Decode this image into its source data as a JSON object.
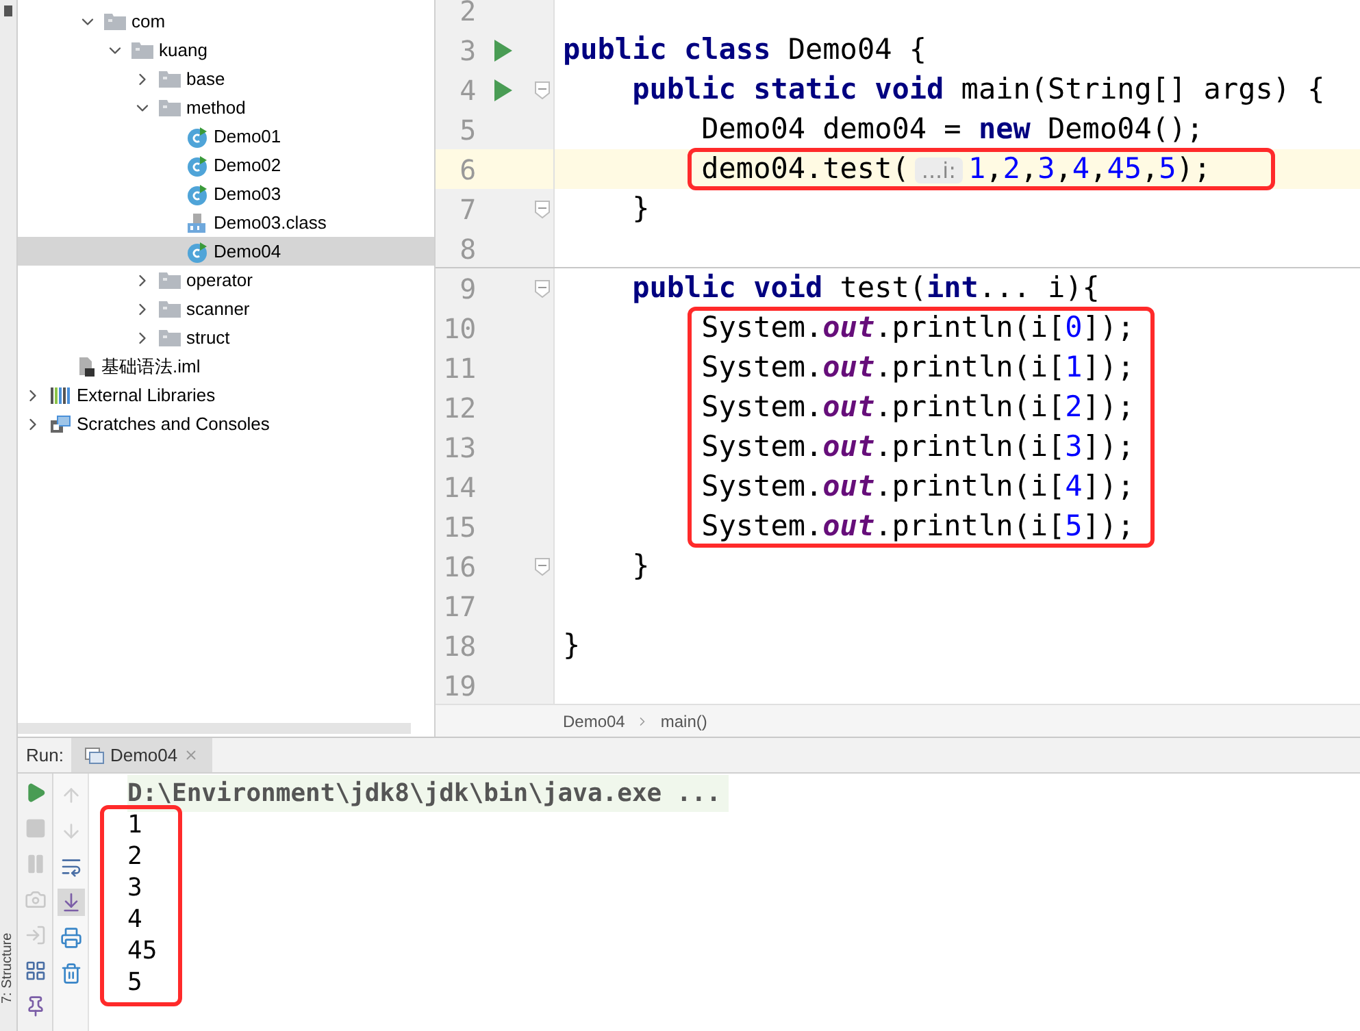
{
  "tool_stripe": {
    "structure_tab": "7: Structure"
  },
  "project_tree": [
    {
      "children": [
        {
          "children": [
            {
              "label": "com",
              "kind": "folder",
              "expanded": true,
              "selected": false,
              "children": [
                {
                  "label": "kuang",
                  "kind": "folder",
                  "expanded": true,
                  "selected": false,
                  "children": [
                    {
                      "label": "base",
                      "kind": "folder",
                      "expanded": false,
                      "selected": false
                    },
                    {
                      "label": "method",
                      "kind": "folder",
                      "expanded": true,
                      "selected": false,
                      "children": [
                        {
                          "label": "Demo01",
                          "kind": "class",
                          "selected": false
                        },
                        {
                          "label": "Demo02",
                          "kind": "class",
                          "selected": false
                        },
                        {
                          "label": "Demo03",
                          "kind": "class",
                          "selected": false
                        },
                        {
                          "label": "Demo03.class",
                          "kind": "classfile",
                          "selected": false
                        },
                        {
                          "label": "Demo04",
                          "kind": "class",
                          "selected": true
                        }
                      ]
                    },
                    {
                      "label": "operator",
                      "kind": "folder",
                      "expanded": false,
                      "selected": false
                    },
                    {
                      "label": "scanner",
                      "kind": "folder",
                      "expanded": false,
                      "selected": false
                    },
                    {
                      "label": "struct",
                      "kind": "folder",
                      "expanded": false,
                      "selected": false
                    }
                  ]
                }
              ]
            }
          ]
        },
        {
          "label": "基础语法.iml",
          "kind": "iml",
          "selected": false
        }
      ]
    },
    {
      "label": "External Libraries",
      "kind": "library",
      "expanded": false,
      "selected": false
    },
    {
      "label": "Scratches and Consoles",
      "kind": "scratches",
      "expanded": false,
      "selected": false
    }
  ],
  "editor": {
    "lines": [
      {
        "number": "2"
      },
      {
        "number": "3",
        "run": true,
        "tokens": [
          {
            "text": "public class ",
            "kind": "kw"
          },
          {
            "text": "Demo04 {",
            "kind": "plain"
          }
        ]
      },
      {
        "number": "4",
        "run": true,
        "fold": true,
        "tokens": [
          {
            "text": "    public static void ",
            "kind": "kw"
          },
          {
            "text": "main(String[] args) {",
            "kind": "plain"
          }
        ]
      },
      {
        "number": "5",
        "tokens": [
          {
            "text": "        Demo04 demo04 = ",
            "kind": "plain"
          },
          {
            "text": "new ",
            "kind": "kw"
          },
          {
            "text": "Demo04();",
            "kind": "plain"
          }
        ]
      },
      {
        "number": "6",
        "tokens": [
          {
            "text": "        demo04.test(",
            "kind": "plain"
          },
          {
            "text": "...i:",
            "kind": "hint"
          },
          {
            "text": "1",
            "kind": "num"
          },
          {
            "text": ",",
            "kind": "plain"
          },
          {
            "text": "2",
            "kind": "num"
          },
          {
            "text": ",",
            "kind": "plain"
          },
          {
            "text": "3",
            "kind": "num"
          },
          {
            "text": ",",
            "kind": "plain"
          },
          {
            "text": "4",
            "kind": "num"
          },
          {
            "text": ",",
            "kind": "plain"
          },
          {
            "text": "45",
            "kind": "num"
          },
          {
            "text": ",",
            "kind": "plain"
          },
          {
            "text": "5",
            "kind": "num"
          },
          {
            "text": ");",
            "kind": "plain"
          }
        ],
        "boxed": true,
        "current": true
      },
      {
        "number": "7",
        "fold": true,
        "tokens": [
          {
            "text": "    }",
            "kind": "plain"
          }
        ]
      },
      {
        "number": "8",
        "separator_after": true
      },
      {
        "number": "9",
        "fold": true,
        "tokens": [
          {
            "text": "    public void ",
            "kind": "kw"
          },
          {
            "text": "test(",
            "kind": "plain"
          },
          {
            "text": "int",
            "kind": "kw"
          },
          {
            "text": "... i){",
            "kind": "plain"
          }
        ]
      },
      {
        "number": "10",
        "tokens": [
          {
            "text": "        System.",
            "kind": "plain"
          },
          {
            "text": "out",
            "kind": "field"
          },
          {
            "text": ".println(i[",
            "kind": "plain"
          },
          {
            "text": "0",
            "kind": "num"
          },
          {
            "text": "]);",
            "kind": "plain"
          }
        ],
        "boxed": true
      },
      {
        "number": "11",
        "tokens": [
          {
            "text": "        System.",
            "kind": "plain"
          },
          {
            "text": "out",
            "kind": "field"
          },
          {
            "text": ".println(i[",
            "kind": "plain"
          },
          {
            "text": "1",
            "kind": "num"
          },
          {
            "text": "]);",
            "kind": "plain"
          }
        ],
        "boxed": true
      },
      {
        "number": "12",
        "tokens": [
          {
            "text": "        System.",
            "kind": "plain"
          },
          {
            "text": "out",
            "kind": "field"
          },
          {
            "text": ".println(i[",
            "kind": "plain"
          },
          {
            "text": "2",
            "kind": "num"
          },
          {
            "text": "]);",
            "kind": "plain"
          }
        ],
        "boxed": true
      },
      {
        "number": "13",
        "tokens": [
          {
            "text": "        System.",
            "kind": "plain"
          },
          {
            "text": "out",
            "kind": "field"
          },
          {
            "text": ".println(i[",
            "kind": "plain"
          },
          {
            "text": "3",
            "kind": "num"
          },
          {
            "text": "]);",
            "kind": "plain"
          }
        ],
        "boxed": true
      },
      {
        "number": "14",
        "tokens": [
          {
            "text": "        System.",
            "kind": "plain"
          },
          {
            "text": "out",
            "kind": "field"
          },
          {
            "text": ".println(i[",
            "kind": "plain"
          },
          {
            "text": "4",
            "kind": "num"
          },
          {
            "text": "]);",
            "kind": "plain"
          }
        ],
        "boxed": true
      },
      {
        "number": "15",
        "tokens": [
          {
            "text": "        System.",
            "kind": "plain"
          },
          {
            "text": "out",
            "kind": "field"
          },
          {
            "text": ".println(i[",
            "kind": "plain"
          },
          {
            "text": "5",
            "kind": "num"
          },
          {
            "text": "]);",
            "kind": "plain"
          }
        ],
        "boxed": true
      },
      {
        "number": "16",
        "fold": true,
        "tokens": [
          {
            "text": "    }",
            "kind": "plain"
          }
        ]
      },
      {
        "number": "17"
      },
      {
        "number": "18",
        "tokens": [
          {
            "text": "}",
            "kind": "plain"
          }
        ]
      },
      {
        "number": "19"
      }
    ],
    "breadcrumbs": [
      "Demo04",
      "main()"
    ]
  },
  "run_panel": {
    "label": "Run:",
    "tab": {
      "title": "Demo04",
      "selected": true
    },
    "left_toolbar": [
      {
        "kind": "run",
        "disabled": false
      },
      {
        "kind": "stop",
        "disabled": true
      },
      {
        "kind": "pause",
        "disabled": true
      },
      {
        "kind": "camera",
        "disabled": true
      },
      {
        "kind": "exit",
        "disabled": true
      },
      {
        "kind": "layout",
        "disabled": false
      },
      {
        "kind": "pin",
        "disabled": false
      }
    ],
    "right_toolbar": [
      {
        "kind": "up",
        "disabled": true,
        "selected": false
      },
      {
        "kind": "down",
        "disabled": true,
        "selected": false
      },
      {
        "kind": "wrap",
        "disabled": false,
        "selected": false
      },
      {
        "kind": "scroll-end",
        "disabled": false,
        "selected": true
      },
      {
        "kind": "print",
        "disabled": false,
        "selected": false
      },
      {
        "kind": "trash",
        "disabled": false,
        "selected": false
      }
    ],
    "console": [
      {
        "text": "D:\\Environment\\jdk8\\jdk\\bin\\java.exe ...",
        "kind": "command"
      },
      {
        "text": "1",
        "kind": "output",
        "boxed": true
      },
      {
        "text": "2",
        "kind": "output",
        "boxed": true
      },
      {
        "text": "3",
        "kind": "output",
        "boxed": true
      },
      {
        "text": "4",
        "kind": "output",
        "boxed": true
      },
      {
        "text": "45",
        "kind": "output",
        "boxed": true
      },
      {
        "text": "5",
        "kind": "output",
        "boxed": true
      }
    ]
  }
}
